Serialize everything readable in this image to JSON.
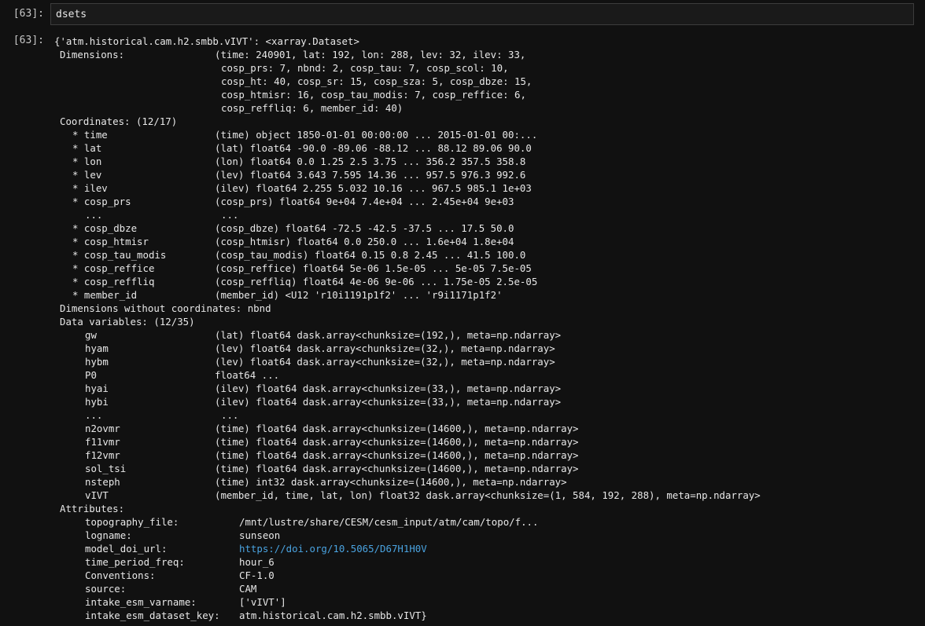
{
  "cell": {
    "in_prompt": "[63]:",
    "input": "dsets",
    "out_prompt": "[63]:"
  },
  "output": {
    "header": "{'atm.historical.cam.h2.smbb.vIVT': <xarray.Dataset>",
    "dimensions_label": "Dimensions:",
    "dimensions": [
      "(time: 240901, lat: 192, lon: 288, lev: 32, ilev: 33,",
      "cosp_prs: 7, nbnd: 2, cosp_tau: 7, cosp_scol: 10,",
      "cosp_ht: 40, cosp_sr: 15, cosp_sza: 5, cosp_dbze: 15,",
      "cosp_htmisr: 16, cosp_tau_modis: 7, cosp_reffice: 6,",
      "cosp_reffliq: 6, member_id: 40)"
    ],
    "coordinates_label": "Coordinates: (12/17)",
    "coordinates": [
      {
        "name": "* time",
        "value": "(time) object 1850-01-01 00:00:00 ... 2015-01-01 00:..."
      },
      {
        "name": "* lat",
        "value": "(lat) float64 -90.0 -89.06 -88.12 ... 88.12 89.06 90.0"
      },
      {
        "name": "* lon",
        "value": "(lon) float64 0.0 1.25 2.5 3.75 ... 356.2 357.5 358.8"
      },
      {
        "name": "* lev",
        "value": "(lev) float64 3.643 7.595 14.36 ... 957.5 976.3 992.6"
      },
      {
        "name": "* ilev",
        "value": "(ilev) float64 2.255 5.032 10.16 ... 967.5 985.1 1e+03"
      },
      {
        "name": "* cosp_prs",
        "value": "(cosp_prs) float64 9e+04 7.4e+04 ... 2.45e+04 9e+03"
      },
      {
        "name": "...",
        "value": "..."
      },
      {
        "name": "* cosp_dbze",
        "value": "(cosp_dbze) float64 -72.5 -42.5 -37.5 ... 17.5 50.0"
      },
      {
        "name": "* cosp_htmisr",
        "value": "(cosp_htmisr) float64 0.0 250.0 ... 1.6e+04 1.8e+04"
      },
      {
        "name": "* cosp_tau_modis",
        "value": "(cosp_tau_modis) float64 0.15 0.8 2.45 ... 41.5 100.0"
      },
      {
        "name": "* cosp_reffice",
        "value": "(cosp_reffice) float64 5e-06 1.5e-05 ... 5e-05 7.5e-05"
      },
      {
        "name": "* cosp_reffliq",
        "value": "(cosp_reffliq) float64 4e-06 9e-06 ... 1.75e-05 2.5e-05"
      },
      {
        "name": "* member_id",
        "value": "(member_id) <U12 'r10i1191p1f2' ... 'r9i1171p1f2'"
      }
    ],
    "dims_without_coords": "Dimensions without coordinates: nbnd",
    "data_vars_label": "Data variables: (12/35)",
    "data_vars": [
      {
        "name": "gw",
        "value": "(lat) float64 dask.array<chunksize=(192,), meta=np.ndarray>"
      },
      {
        "name": "hyam",
        "value": "(lev) float64 dask.array<chunksize=(32,), meta=np.ndarray>"
      },
      {
        "name": "hybm",
        "value": "(lev) float64 dask.array<chunksize=(32,), meta=np.ndarray>"
      },
      {
        "name": "P0",
        "value": "float64 ..."
      },
      {
        "name": "hyai",
        "value": "(ilev) float64 dask.array<chunksize=(33,), meta=np.ndarray>"
      },
      {
        "name": "hybi",
        "value": "(ilev) float64 dask.array<chunksize=(33,), meta=np.ndarray>"
      },
      {
        "name": "...",
        "value": "..."
      },
      {
        "name": "n2ovmr",
        "value": "(time) float64 dask.array<chunksize=(14600,), meta=np.ndarray>"
      },
      {
        "name": "f11vmr",
        "value": "(time) float64 dask.array<chunksize=(14600,), meta=np.ndarray>"
      },
      {
        "name": "f12vmr",
        "value": "(time) float64 dask.array<chunksize=(14600,), meta=np.ndarray>"
      },
      {
        "name": "sol_tsi",
        "value": "(time) float64 dask.array<chunksize=(14600,), meta=np.ndarray>"
      },
      {
        "name": "nsteph",
        "value": "(time) int32 dask.array<chunksize=(14600,), meta=np.ndarray>"
      },
      {
        "name": "vIVT",
        "value": "(member_id, time, lat, lon) float32 dask.array<chunksize=(1, 584, 192, 288), meta=np.ndarray>"
      }
    ],
    "attributes_label": "Attributes:",
    "attributes": [
      {
        "name": "topography_file:",
        "value": "/mnt/lustre/share/CESM/cesm_input/atm/cam/topo/f..."
      },
      {
        "name": "logname:",
        "value": "sunseon"
      },
      {
        "name": "model_doi_url:",
        "value": "https://doi.org/10.5065/D67H1H0V"
      },
      {
        "name": "time_period_freq:",
        "value": "hour_6"
      },
      {
        "name": "Conventions:",
        "value": "CF-1.0"
      },
      {
        "name": "source:",
        "value": "CAM"
      },
      {
        "name": "intake_esm_varname:",
        "value": "['vIVT']"
      },
      {
        "name": "intake_esm_dataset_key:",
        "value": "atm.historical.cam.h2.smbb.vIVT}"
      }
    ],
    "link_color": "#4aa3e0"
  }
}
